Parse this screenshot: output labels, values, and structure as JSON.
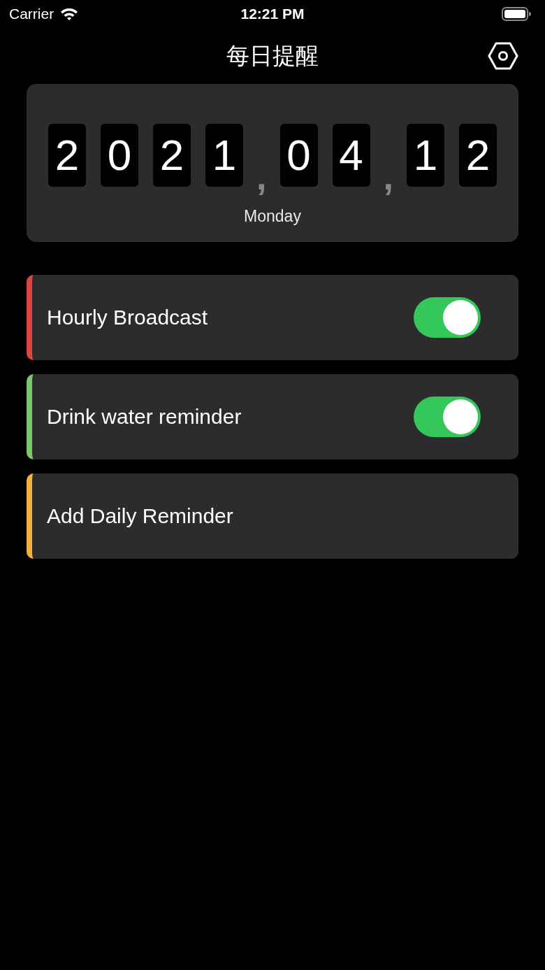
{
  "status_bar": {
    "carrier": "Carrier",
    "time": "12:21 PM"
  },
  "nav": {
    "title": "每日提醒"
  },
  "date_card": {
    "tiles": [
      {
        "kind": "digit",
        "text": "2"
      },
      {
        "kind": "digit",
        "text": "0"
      },
      {
        "kind": "digit",
        "text": "2"
      },
      {
        "kind": "digit",
        "text": "1"
      },
      {
        "kind": "separator",
        "text": ","
      },
      {
        "kind": "digit",
        "text": "0"
      },
      {
        "kind": "digit",
        "text": "4"
      },
      {
        "kind": "separator",
        "text": ","
      },
      {
        "kind": "digit",
        "text": "1"
      },
      {
        "kind": "digit",
        "text": "2"
      }
    ],
    "weekday": "Monday"
  },
  "reminders": [
    {
      "kind": "toggle",
      "label": "Hourly Broadcast",
      "color": "#e0443e",
      "on": true
    },
    {
      "kind": "toggle",
      "label": "Drink water reminder",
      "color": "#7bc76e",
      "on": true
    },
    {
      "kind": "action",
      "label": "Add Daily Reminder",
      "color": "#f0b23d"
    }
  ]
}
